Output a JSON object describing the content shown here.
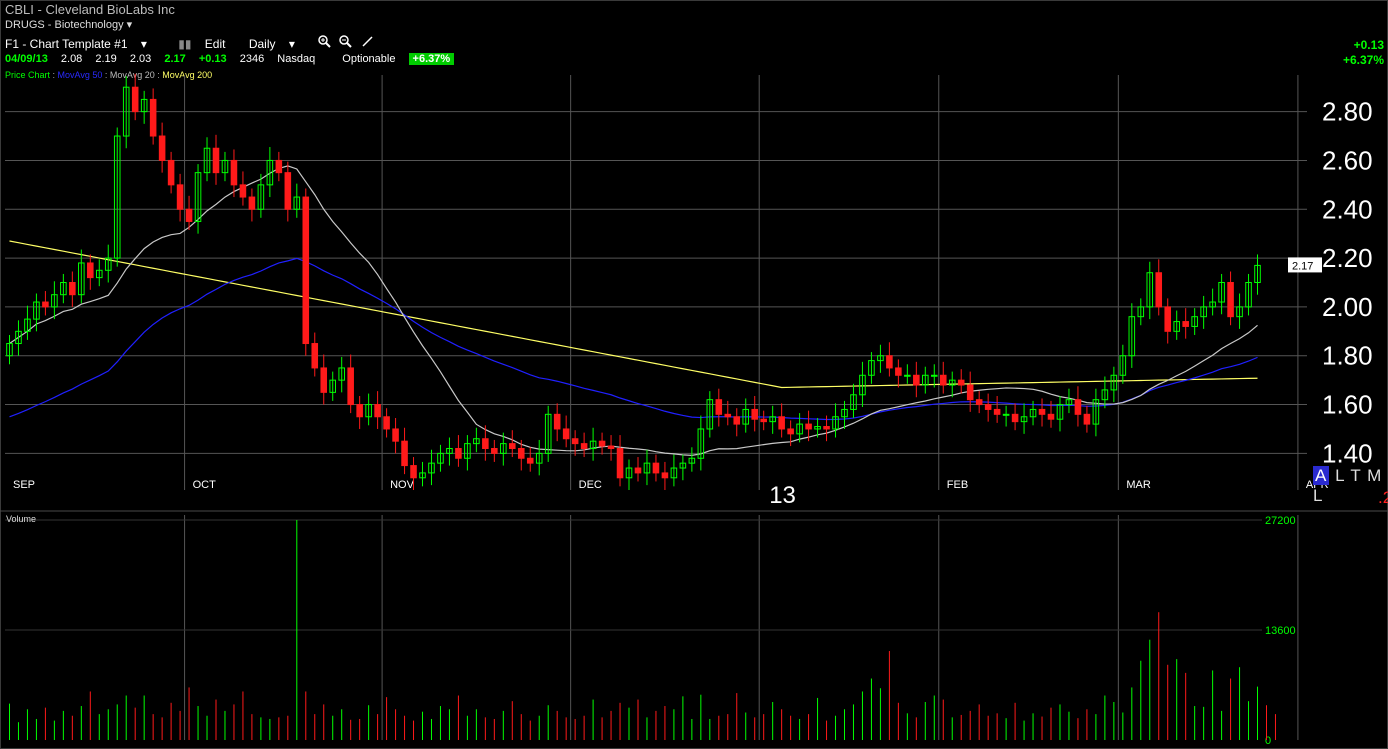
{
  "header": {
    "title": "CBLI - Cleveland BioLabs Inc",
    "industry": "DRUGS - Biotechnology",
    "template_label": "F1 - Chart Template #1",
    "edit_label": "Edit",
    "period_label": "Daily",
    "date": "04/09/13",
    "open": "2.08",
    "high": "2.19",
    "low": "2.03",
    "close": "2.17",
    "change": "+0.13",
    "volume": "2346",
    "exchange": "Nasdaq",
    "optionable": "Optionable",
    "pct_badge": "+6.37%",
    "right_change": "+0.13",
    "right_pct": "+6.37%"
  },
  "studies": {
    "price_chart": "Price Chart",
    "ma50": "MovAvg 50",
    "ma20": "MovAvg 20",
    "ma200": "MovAvg 200"
  },
  "colors": {
    "up": "#00ff00",
    "down": "#ff1a1a",
    "ma50": "#2020ff",
    "ma20": "#c8c8c8",
    "ma200": "#ffff66",
    "grid": "#555555"
  },
  "toolbar_icons": [
    "zoom-in-icon",
    "zoom-out-icon",
    "draw-pencil-icon"
  ],
  "altml": {
    "a": "A",
    "rest": "L T M L",
    "extra": ".2"
  },
  "last_price_tag": "2.17",
  "volume_title": "Volume",
  "chart_data": [
    {
      "type": "candlestick",
      "title": "CBLI - Cleveland BioLabs Inc",
      "ylim": [
        1.25,
        2.95
      ],
      "yticks": [
        {
          "v": 1.4,
          "label": "1.40"
        },
        {
          "v": 1.6,
          "label": "1.60"
        },
        {
          "v": 1.8,
          "label": "1.80"
        },
        {
          "v": 2.0,
          "label": "2.00"
        },
        {
          "v": 2.2,
          "label": "2.20"
        },
        {
          "v": 2.4,
          "label": "2.40"
        },
        {
          "v": 2.6,
          "label": "2.60"
        },
        {
          "v": 2.8,
          "label": "2.80"
        }
      ],
      "month_labels": [
        {
          "label": "SEP",
          "i": 0
        },
        {
          "label": "OCT",
          "i": 20
        },
        {
          "label": "NOV",
          "i": 42
        },
        {
          "label": "DEC",
          "i": 63
        },
        {
          "label": "FEB",
          "i": 104
        },
        {
          "label": "MAR",
          "i": 124
        },
        {
          "label": "APR",
          "i": 144
        }
      ],
      "year_label": {
        "label": "13",
        "i": 84
      },
      "closes": [
        1.85,
        1.9,
        1.95,
        2.02,
        2.0,
        2.05,
        2.1,
        2.05,
        2.18,
        2.12,
        2.15,
        2.2,
        2.7,
        2.9,
        2.8,
        2.85,
        2.7,
        2.6,
        2.5,
        2.4,
        2.35,
        2.55,
        2.65,
        2.55,
        2.6,
        2.5,
        2.45,
        2.4,
        2.5,
        2.6,
        2.55,
        2.4,
        2.45,
        1.85,
        1.75,
        1.65,
        1.7,
        1.75,
        1.6,
        1.55,
        1.6,
        1.55,
        1.5,
        1.45,
        1.35,
        1.3,
        1.32,
        1.36,
        1.4,
        1.42,
        1.38,
        1.44,
        1.46,
        1.42,
        1.4,
        1.44,
        1.42,
        1.38,
        1.36,
        1.4,
        1.56,
        1.5,
        1.46,
        1.44,
        1.42,
        1.45,
        1.43,
        1.42,
        1.3,
        1.34,
        1.32,
        1.36,
        1.32,
        1.3,
        1.34,
        1.36,
        1.38,
        1.5,
        1.62,
        1.56,
        1.55,
        1.52,
        1.58,
        1.54,
        1.53,
        1.55,
        1.5,
        1.48,
        1.52,
        1.5,
        1.51,
        1.5,
        1.55,
        1.58,
        1.64,
        1.72,
        1.78,
        1.8,
        1.75,
        1.72,
        1.72,
        1.68,
        1.72,
        1.72,
        1.68,
        1.7,
        1.68,
        1.62,
        1.6,
        1.58,
        1.56,
        1.56,
        1.53,
        1.55,
        1.58,
        1.56,
        1.54,
        1.6,
        1.62,
        1.56,
        1.52,
        1.62,
        1.66,
        1.72,
        1.8,
        1.96,
        2.0,
        2.14,
        2.0,
        1.9,
        1.94,
        1.92,
        1.96,
        2.0,
        2.02,
        2.1,
        1.96,
        2.0,
        2.1,
        2.17
      ],
      "volume": {
        "ylim": [
          0,
          27200
        ],
        "yticks": [
          {
            "v": 0,
            "label": "0"
          },
          {
            "v": 13600,
            "label": "13600"
          },
          {
            "v": 27200,
            "label": "27200"
          }
        ],
        "values": [
          4500,
          2200,
          3800,
          2600,
          4000,
          2400,
          3600,
          3000,
          4200,
          6000,
          3200,
          3800,
          4400,
          5500,
          4000,
          5500,
          3200,
          2800,
          4600,
          3600,
          6500,
          4200,
          3000,
          5000,
          3600,
          4400,
          6000,
          3200,
          2800,
          2600,
          2800,
          3000,
          27200,
          6000,
          3200,
          4400,
          3000,
          3800,
          2500,
          2600,
          4300,
          3200,
          5300,
          3800,
          3000,
          2400,
          3500,
          2600,
          4200,
          3800,
          5500,
          3000,
          3800,
          2800,
          2600,
          3600,
          4800,
          3200,
          2400,
          3000,
          4300,
          3600,
          2800,
          2600,
          3000,
          5000,
          2800,
          3600,
          4600,
          4000,
          5000,
          2800,
          3600,
          4200,
          3800,
          5400,
          2600,
          5600,
          2600,
          3000,
          3200,
          5800,
          3400,
          2800,
          3200,
          4700,
          3800,
          3000,
          2600,
          3200,
          5200,
          2400,
          3000,
          3800,
          4400,
          6000,
          7600,
          6400,
          11000,
          4600,
          3300,
          2800,
          4700,
          5500,
          5000,
          2800,
          3100,
          3600,
          4400,
          3000,
          3300,
          2700,
          4600,
          2400,
          3300,
          2900,
          4000,
          4400,
          3500,
          2700,
          3800,
          3200,
          5500,
          4700,
          3400,
          6500,
          9800,
          12400,
          15800,
          9300,
          10000,
          8300,
          4200,
          4100,
          8600,
          3600,
          7600,
          9000,
          4800,
          6600,
          4300,
          3200
        ]
      }
    }
  ]
}
